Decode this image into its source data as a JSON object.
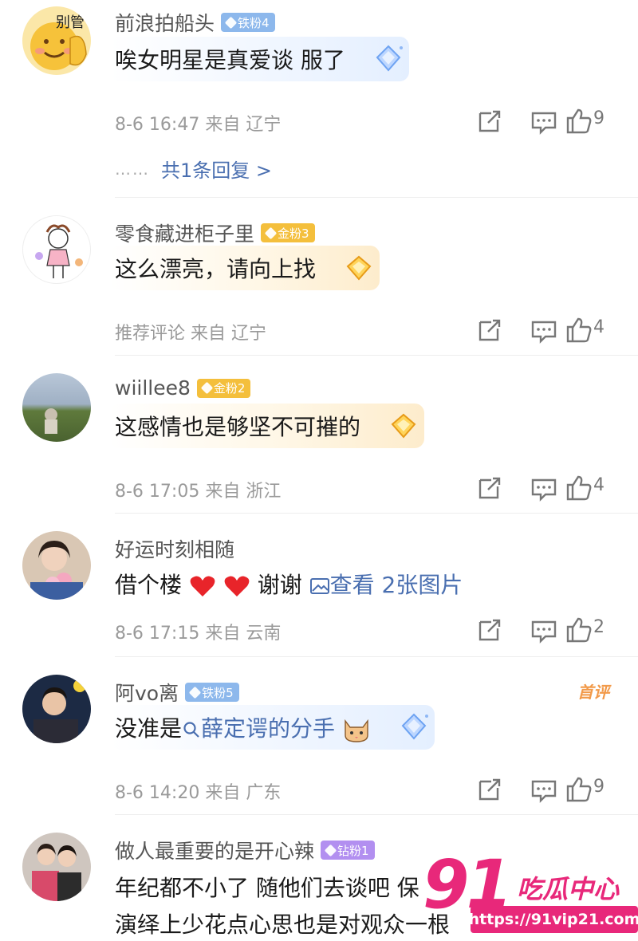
{
  "comments": [
    {
      "user": "前浪拍船头",
      "badge": "铁粉4",
      "text": "唉女明星是真爱谈 服了",
      "meta": "8-6 16:47 来自 辽宁",
      "likes": "9",
      "replies": "共1条回复 >",
      "replies_dots": "……",
      "avatar_text": "别管"
    },
    {
      "user": "零食藏进柜子里",
      "badge": "金粉3",
      "text": "这么漂亮，请向上找",
      "meta": "推荐评论 来自 辽宁",
      "likes": "4"
    },
    {
      "user": "wiillee8",
      "badge": "金粉2",
      "text": "这感情也是够坚不可摧的",
      "meta": "8-6 17:05 来自 浙江",
      "likes": "4"
    },
    {
      "user": "好运时刻相随",
      "text_prefix": "借个楼",
      "text_suffix": "谢谢",
      "text_link": "查看 2张图片",
      "meta": "8-6 17:15 来自 云南",
      "likes": "2"
    },
    {
      "user": "阿vo离",
      "badge": "铁粉5",
      "text_prefix": "没准是",
      "text_link": "薛定谔的分手",
      "meta": "8-6 14:20 来自 广东",
      "likes": "9",
      "tag": "首评"
    },
    {
      "user": "做人最重要的是开心辣",
      "badge": "钻粉1",
      "text_line1": "年纪都不小了 随他们去谈吧 保",
      "text_line2": "演绎上少花点心思也是对观众一根"
    }
  ],
  "watermark": {
    "big": "91",
    "cn": "吃瓜中心",
    "url": "https://91vip21.com"
  },
  "colors": {
    "iron_badge": "#8db8ec",
    "gold_badge": "#f4bf3c",
    "diamond_badge": "#b28ff0",
    "link": "#4a6fb0",
    "watermark": "#e8287a"
  }
}
